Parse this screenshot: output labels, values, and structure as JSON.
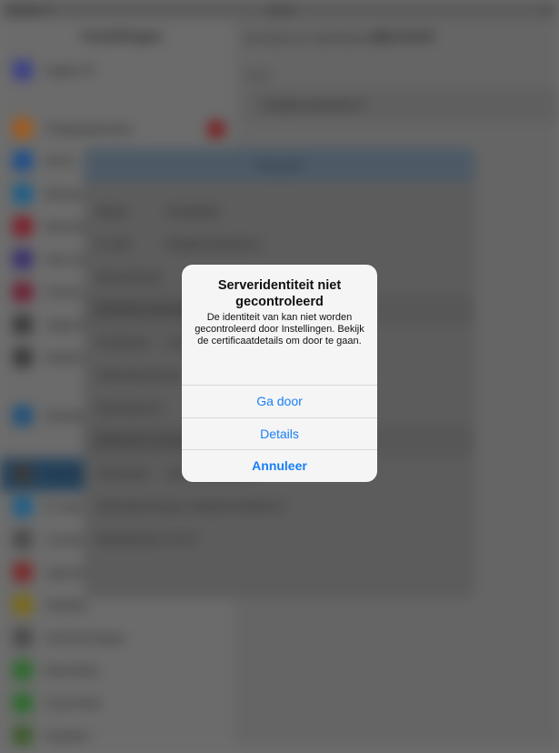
{
  "alert": {
    "title": "Serveridentiteit niet gecontroleerd",
    "message": "De identiteit van  kan niet worden gecontroleerd door Instellingen. Bekijk de certificaatdetails om door te gaan.",
    "buttons": {
      "continue": "Ga door",
      "details": "Details",
      "cancel": "Annuleer"
    },
    "button_color": "#1a7ff5"
  },
  "background": {
    "status_bar": {
      "left": "●●●●● ✦",
      "center": "09:41",
      "right": "▭"
    },
    "sidebar_title": "Instellingen",
    "detail_back": "Accounts en wachtwoorden",
    "detail_title": "Account",
    "sidebar_items": [
      {
        "label": "Apple ID",
        "icon": "account-avatar-icon",
        "color": "#3b3f86"
      },
      {
        "label": "Vliegtuigmodus",
        "icon": "airplane-icon",
        "color": "#a35a1a"
      },
      {
        "label": "Wi‑Fi",
        "icon": "wifi-icon",
        "color": "#1c4d8a"
      },
      {
        "label": "Bluetooth",
        "icon": "bluetooth-icon",
        "color": "#1d5d87"
      },
      {
        "label": "Berichtgeving",
        "icon": "notifications-icon",
        "color": "#7c1f2a"
      },
      {
        "label": "Niet storen",
        "icon": "moon-icon",
        "color": "#3a2f6b"
      },
      {
        "label": "Schermtijd",
        "icon": "hourglass-icon",
        "color": "#6b2134"
      },
      {
        "label": "Algemeen",
        "icon": "gear-icon",
        "color": "#3a3a3a"
      },
      {
        "label": "Bedieningspaneel",
        "icon": "toggles-icon",
        "color": "#3a3a3a"
      },
      {
        "label": "Beeldscherm en helderheid",
        "icon": "display-icon",
        "color": "#1e4f7a"
      },
      {
        "label": "Accounts en wachtwoorden",
        "icon": "key-icon",
        "color": "#3a3a3a"
      },
      {
        "label": "E‑mail",
        "icon": "mail-icon",
        "color": "#1d5d87"
      },
      {
        "label": "Contacten",
        "icon": "contacts-icon",
        "color": "#4a4a4a"
      },
      {
        "label": "Agenda",
        "icon": "calendar-icon",
        "color": "#7a2a2a"
      },
      {
        "label": "Notities",
        "icon": "notes-icon",
        "color": "#7a6a1a"
      },
      {
        "label": "Herinneringen",
        "icon": "reminders-icon",
        "color": "#4a4a4a"
      },
      {
        "label": "Berichten",
        "icon": "messages-icon",
        "color": "#2c6a2c"
      },
      {
        "label": "FaceTime",
        "icon": "facetime-icon",
        "color": "#2c6a2c"
      },
      {
        "label": "Kaarten",
        "icon": "maps-icon",
        "color": "#3d5a2c"
      }
    ],
    "detail_section_header": "IMAP",
    "detail_row": "info@voorbeeld.nl",
    "sheet": {
      "title": "Account",
      "rows": [
        {
          "key": "Naam",
          "value": "Voorbeeld"
        },
        {
          "key": "E-mail",
          "value": "info@voorbeeld.nl"
        },
        {
          "key": "Beschrijving",
          "value": ""
        },
        {
          "key": "SERVER INKOMENDE POST",
          "value": ""
        },
        {
          "key": "Hostnaam",
          "value": "mail.voorbeeld.nl"
        },
        {
          "key": "Gebruikersnaam",
          "value": ""
        },
        {
          "key": "Wachtwoord",
          "value": ""
        },
        {
          "key": "SERVER UITGAANDE POST",
          "value": ""
        },
        {
          "key": "Hostnaam",
          "value": "mail.voorbeeld.nl"
        },
        {
          "key": "Gebruikersnaam",
          "value": "info@voorbeeld.nl"
        },
        {
          "key": "Wachtwoord",
          "value": "••••••••"
        }
      ]
    }
  }
}
